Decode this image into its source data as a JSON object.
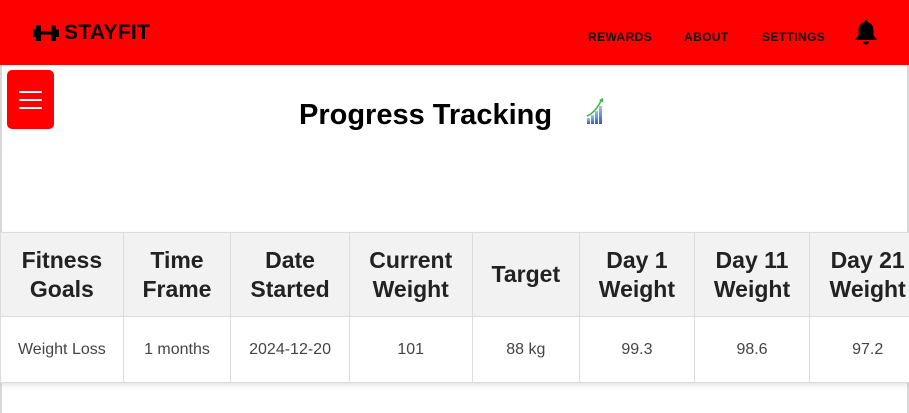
{
  "header": {
    "brand": "STAYFIT",
    "nav": {
      "rewards": "REWARDS",
      "about": "ABOUT",
      "settings": "SETTINGS"
    },
    "icons": {
      "logo": "dumbbell-icon",
      "notifications": "bell-icon"
    },
    "colors": {
      "bar": "#ff0000",
      "text": "#000000"
    }
  },
  "menu": {
    "icon": "hamburger-menu-icon"
  },
  "page": {
    "title": "Progress Tracking",
    "title_icon": "growth-chart-icon"
  },
  "table": {
    "headers": [
      "Fitness Goals",
      "Time Frame",
      "Date Started",
      "Current Weight",
      "Target",
      "Day 1 Weight",
      "Day 11 Weight",
      "Day 21 Weight"
    ],
    "rows": [
      [
        "Weight Loss",
        "1 months",
        "2024-12-20",
        "101",
        "88 kg",
        "99.3",
        "98.6",
        "97.2"
      ]
    ]
  }
}
